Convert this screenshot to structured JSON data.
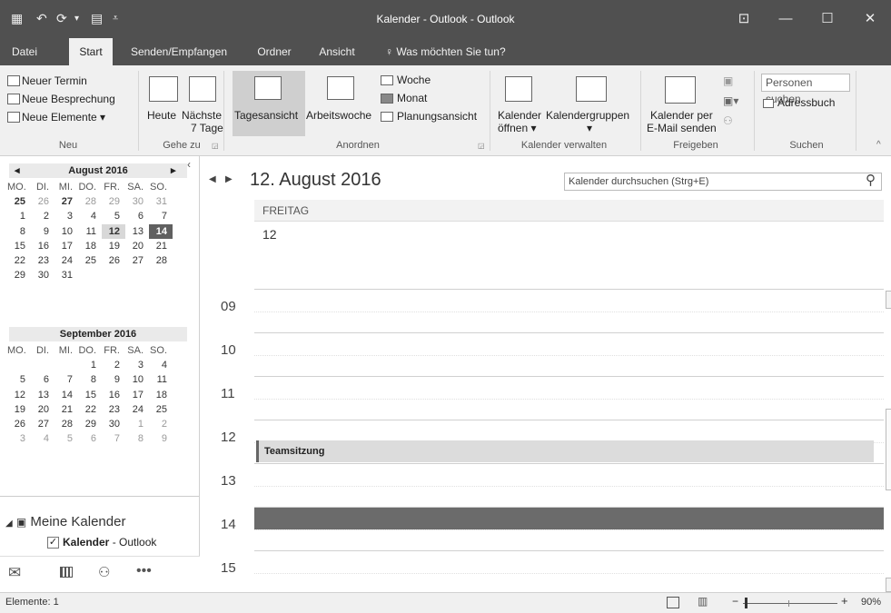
{
  "window": {
    "title": "Kalender - Outlook - Outlook",
    "controls": [
      "⊡",
      "—",
      "☐",
      "✕"
    ]
  },
  "tabs": [
    {
      "label": "Datei",
      "active": false
    },
    {
      "label": "Start",
      "active": true
    },
    {
      "label": "Senden/Empfangen",
      "active": false
    },
    {
      "label": "Ordner",
      "active": false
    },
    {
      "label": "Ansicht",
      "active": false
    },
    {
      "label": "Was möchten Sie tun?",
      "active": false
    }
  ],
  "ribbon": {
    "neu": {
      "neuer_termin": "Neuer Termin",
      "neue_besprechung": "Neue Besprechung",
      "neue_elemente": "Neue Elemente",
      "label": "Neu"
    },
    "gehezu": {
      "heute": "Heute",
      "naechste_1": "Nächste",
      "naechste_2": "7 Tage",
      "label": "Gehe zu"
    },
    "anordnen": {
      "tagesansicht": "Tagesansicht",
      "arbeitswoche": "Arbeitswoche",
      "woche": "Woche",
      "monat": "Monat",
      "planungsansicht": "Planungsansicht",
      "label": "Anordnen"
    },
    "verwalten": {
      "kalender_oeffnen_1": "Kalender",
      "kalender_oeffnen_2": "öffnen",
      "kalendergruppen": "Kalendergruppen",
      "label": "Kalender verwalten"
    },
    "freigeben": {
      "per_email_1": "Kalender per",
      "per_email_2": "E-Mail senden",
      "label": "Freigeben"
    },
    "suchen": {
      "personen_placeholder": "Personen suchen",
      "adressbuch": "Adressbuch",
      "label": "Suchen"
    }
  },
  "minical": {
    "months": [
      {
        "title": "August 2016",
        "dow": [
          "MO.",
          "DI.",
          "MI.",
          "DO.",
          "FR.",
          "SA.",
          "SO."
        ],
        "weeks": [
          [
            "25",
            "26",
            "27",
            "28",
            "29",
            "30",
            "31"
          ],
          [
            "1",
            "2",
            "3",
            "4",
            "5",
            "6",
            "7"
          ],
          [
            "8",
            "9",
            "10",
            "11",
            "12",
            "13",
            "14"
          ],
          [
            "15",
            "16",
            "17",
            "18",
            "19",
            "20",
            "21"
          ],
          [
            "22",
            "23",
            "24",
            "25",
            "26",
            "27",
            "28"
          ],
          [
            "29",
            "30",
            "31",
            "",
            "",
            "",
            ""
          ]
        ]
      },
      {
        "title": "September 2016",
        "dow": [
          "MO.",
          "DI.",
          "MI.",
          "DO.",
          "FR.",
          "SA.",
          "SO."
        ],
        "weeks": [
          [
            "",
            "",
            "",
            "1",
            "2",
            "3",
            "4"
          ],
          [
            "5",
            "6",
            "7",
            "8",
            "9",
            "10",
            "11"
          ],
          [
            "12",
            "13",
            "14",
            "15",
            "16",
            "17",
            "18"
          ],
          [
            "19",
            "20",
            "21",
            "22",
            "23",
            "24",
            "25"
          ],
          [
            "26",
            "27",
            "28",
            "29",
            "30",
            "1",
            "2"
          ],
          [
            "3",
            "4",
            "5",
            "6",
            "7",
            "8",
            "9"
          ]
        ]
      }
    ]
  },
  "folders": {
    "group": "Meine Kalender",
    "calendar_name": "Kalender",
    "calendar_suffix": " - Outlook"
  },
  "main": {
    "date_title": "12. August 2016",
    "search_placeholder": "Kalender durchsuchen (Strg+E)",
    "day_name": "FREITAG",
    "day_number": "12",
    "hours": [
      "09",
      "10",
      "11",
      "12",
      "13",
      "14",
      "15"
    ],
    "event": {
      "title": "Teamsitzung"
    }
  },
  "status": {
    "elements": "Elemente: 1",
    "zoom": "90%"
  }
}
